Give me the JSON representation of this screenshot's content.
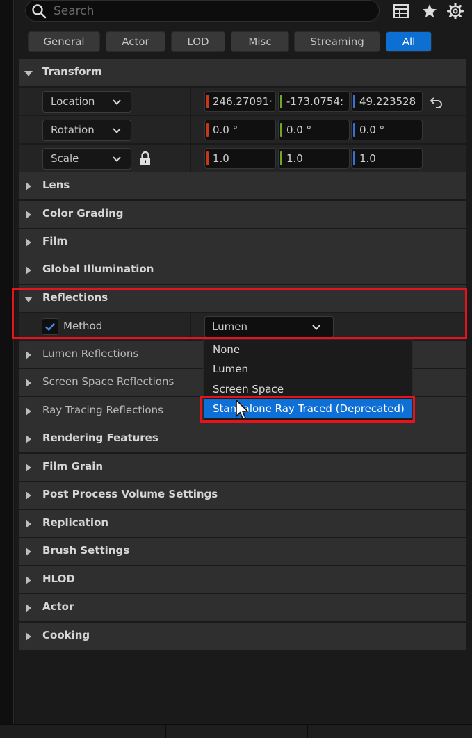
{
  "search": {
    "placeholder": "Search"
  },
  "toolbar": {
    "icons": [
      "grid-icon",
      "star-icon",
      "gear-icon"
    ]
  },
  "tabs": [
    {
      "label": "General"
    },
    {
      "label": "Actor"
    },
    {
      "label": "LOD"
    },
    {
      "label": "Misc"
    },
    {
      "label": "Streaming"
    },
    {
      "label": "All",
      "active": true
    }
  ],
  "transform": {
    "title": "Transform",
    "location": {
      "label": "Location",
      "x": "246.27091·",
      "y": "-173.0754:",
      "z": "49.223528"
    },
    "rotation": {
      "label": "Rotation",
      "x": "0.0 °",
      "y": "0.0 °",
      "z": "0.0 °"
    },
    "scale": {
      "label": "Scale",
      "x": "1.0",
      "y": "1.0",
      "z": "1.0"
    }
  },
  "categories_before": [
    "Lens",
    "Color Grading",
    "Film",
    "Global Illumination"
  ],
  "reflections": {
    "title": "Reflections",
    "method_label": "Method",
    "method_value": "Lumen",
    "method_enabled": true,
    "options": [
      "None",
      "Lumen",
      "Screen Space",
      "Standalone Ray Traced (Deprecated)"
    ],
    "hovered_option": "Standalone Ray Traced (Deprecated)"
  },
  "sub_categories": [
    "Lumen Reflections",
    "Screen Space Reflections",
    "Ray Tracing Reflections"
  ],
  "categories_after": [
    "Rendering Features",
    "Film Grain",
    "Post Process Volume Settings",
    "Replication",
    "Brush Settings",
    "HLOD",
    "Actor",
    "Cooking"
  ],
  "colors": {
    "x_axis": "#c4391c",
    "y_axis": "#6fa82a",
    "z_axis": "#3b6fd1",
    "accent": "#0d6fd1",
    "highlight": "#e3141b"
  }
}
